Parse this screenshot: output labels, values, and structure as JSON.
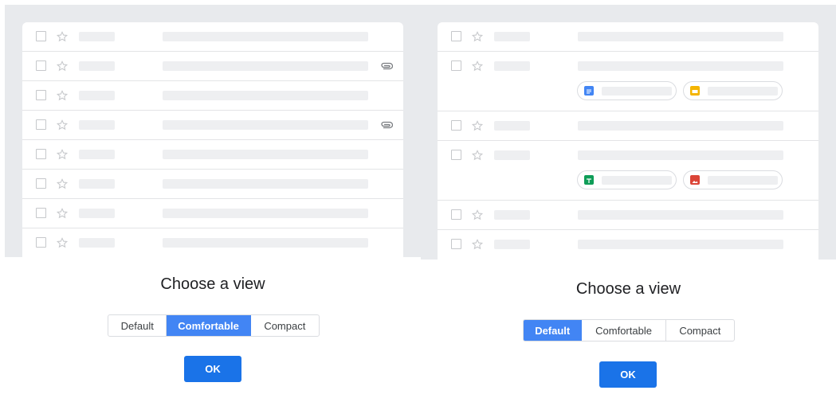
{
  "colors": {
    "selected": "#4285f4",
    "ok_button": "#1a73e8",
    "preview_bg": "#e8eaed"
  },
  "left_panel": {
    "title": "Choose a view",
    "options": [
      "Default",
      "Comfortable",
      "Compact"
    ],
    "selected_option": "Comfortable",
    "ok_label": "OK",
    "rows_attachment_icons": [
      "none",
      "paperclip-icon",
      "none",
      "paperclip-icon",
      "none",
      "none",
      "none",
      "none"
    ]
  },
  "right_panel": {
    "title": "Choose a view",
    "options": [
      "Default",
      "Comfortable",
      "Compact"
    ],
    "selected_option": "Default",
    "ok_label": "OK",
    "attachment_chip_icons": [
      [
        "docs-icon",
        "slides-icon"
      ],
      [
        "sheets-icon",
        "image-icon"
      ]
    ]
  }
}
